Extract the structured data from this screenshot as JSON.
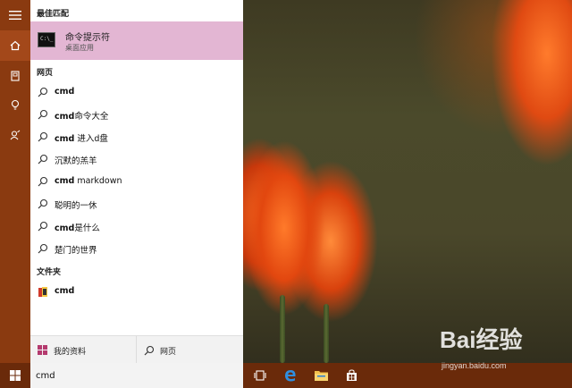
{
  "search_panel": {
    "best_match_label": "最佳匹配",
    "best_match": {
      "title": "命令提示符",
      "subtitle": "桌面应用"
    },
    "web_label": "网页",
    "web_items": [
      {
        "bold": "cmd",
        "rest": ""
      },
      {
        "bold": "cmd",
        "rest": "命令大全"
      },
      {
        "bold": "cmd",
        "rest": " 进入d盘"
      },
      {
        "bold": "",
        "rest": "沉默的羔羊"
      },
      {
        "bold": "cmd",
        "rest": " markdown"
      },
      {
        "bold": "",
        "rest": "聪明的一休"
      },
      {
        "bold": "cmd",
        "rest": "是什么"
      },
      {
        "bold": "",
        "rest": "楚门的世界"
      }
    ],
    "folder_label": "文件夹",
    "folder_item": "cmd",
    "bottom_left": "我的资料",
    "bottom_right": "网页"
  },
  "taskbar": {
    "search_value": "cmd"
  },
  "watermark": {
    "brand": "Bai经验",
    "url": "jingyan.baidu.com"
  },
  "colors": {
    "rail": "#8a3a10",
    "best_match_bg": "#e3b6d3",
    "taskbar": "#6a2a0a"
  }
}
